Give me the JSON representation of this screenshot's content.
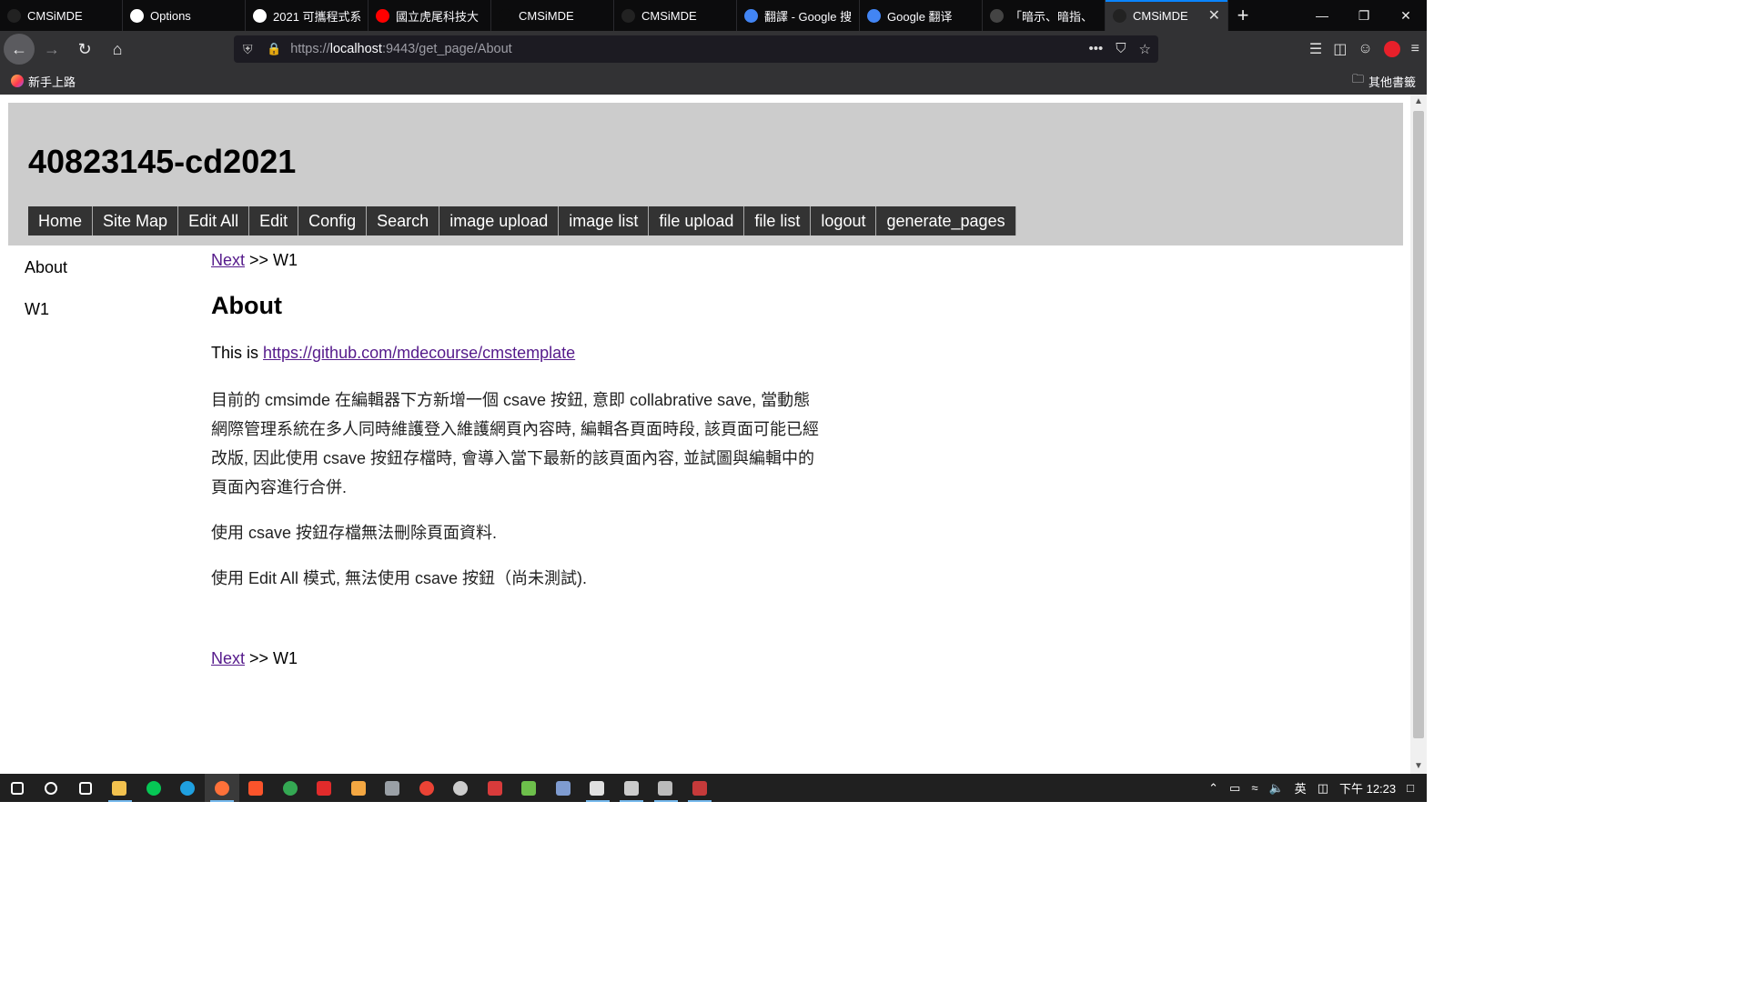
{
  "browser": {
    "tabs": [
      {
        "title": "CMSiMDE",
        "icon": "cmsimde-favicon",
        "color": "#222222"
      },
      {
        "title": "Options",
        "icon": "github-favicon",
        "color": "#ffffff"
      },
      {
        "title": "2021 可攜程式系",
        "icon": "github-favicon",
        "color": "#ffffff"
      },
      {
        "title": "國立虎尾科技大",
        "icon": "youtube-favicon",
        "color": "#ff0000"
      },
      {
        "title": "CMSiMDE",
        "icon": "none",
        "color": "#0c0c0d"
      },
      {
        "title": "CMSiMDE",
        "icon": "cmsimde-favicon",
        "color": "#222222"
      },
      {
        "title": "翻譯 - Google 搜",
        "icon": "google-favicon",
        "color": "#4285f4"
      },
      {
        "title": "Google 翻译",
        "icon": "google-translate-favicon",
        "color": "#4285f4"
      },
      {
        "title": "「暗示、暗指、",
        "icon": "site-favicon",
        "color": "#444444"
      },
      {
        "title": "CMSiMDE",
        "icon": "cmsimde-favicon",
        "color": "#222222"
      }
    ],
    "active_tab_index": 9,
    "new_tab_glyph": "+",
    "url": {
      "scheme": "https://",
      "host": "localhost",
      "rest": ":9443/get_page/About"
    },
    "url_actions": [
      "•••",
      "⛉",
      "☆"
    ],
    "bookmarks": {
      "first": "新手上路",
      "other": "其他書籤"
    }
  },
  "site": {
    "title": "40823145-cd2021",
    "menu": [
      "Home",
      "Site Map",
      "Edit All",
      "Edit",
      "Config",
      "Search",
      "image upload",
      "image list",
      "file upload",
      "file list",
      "logout",
      "generate_pages"
    ],
    "sidebar": [
      "About",
      "W1"
    ]
  },
  "page": {
    "nav_next_label": "Next",
    "nav_separator": " >> W1",
    "heading": "About",
    "intro_prefix": "This is ",
    "intro_link": "https://github.com/mdecourse/cmstemplate",
    "paragraphs": [
      "目前的 cmsimde 在編輯器下方新增一個 csave 按鈕, 意即 collabrative save, 當動態網際管理系統在多人同時維護登入維護網頁內容時, 編輯各頁面時段, 該頁面可能已經改版, 因此使用 csave 按鈕存檔時, 會導入當下最新的該頁面內容, 並試圖與編輯中的頁面內容進行合併.",
      "使用 csave 按鈕存檔無法刪除頁面資料.",
      "使用 Edit All 模式, 無法使用 csave 按鈕（尚未測試)."
    ]
  },
  "taskbar": {
    "time": "下午 12:23",
    "ime": "英",
    "icons": [
      {
        "name": "start",
        "color": "#ffffff"
      },
      {
        "name": "search",
        "color": "#ffffff"
      },
      {
        "name": "task-view",
        "color": "#ffffff"
      },
      {
        "name": "file-explorer",
        "color": "#f2c14e"
      },
      {
        "name": "line",
        "color": "#06c755"
      },
      {
        "name": "edge",
        "color": "#1fa0e0"
      },
      {
        "name": "firefox",
        "color": "#ff7139"
      },
      {
        "name": "brave",
        "color": "#fb542b"
      },
      {
        "name": "chrome",
        "color": "#34a853"
      },
      {
        "name": "acrobat",
        "color": "#e12b2b"
      },
      {
        "name": "inkscape-like",
        "color": "#f4a742"
      },
      {
        "name": "app-gray",
        "color": "#9aa0a6"
      },
      {
        "name": "app-chrome2",
        "color": "#ea4335"
      },
      {
        "name": "app-circle",
        "color": "#cccccc"
      },
      {
        "name": "app-red",
        "color": "#d83b3b"
      },
      {
        "name": "app-hex",
        "color": "#6dbf4b"
      },
      {
        "name": "app-blue",
        "color": "#7f9cd1"
      },
      {
        "name": "app-doc",
        "color": "#e0e0e0"
      },
      {
        "name": "terminal",
        "color": "#cccccc"
      },
      {
        "name": "app-gear",
        "color": "#bbbbbb"
      },
      {
        "name": "app-red2",
        "color": "#c63a3a"
      }
    ],
    "active_index": 6,
    "open_indices": [
      3,
      6,
      17,
      18,
      19,
      20
    ]
  }
}
